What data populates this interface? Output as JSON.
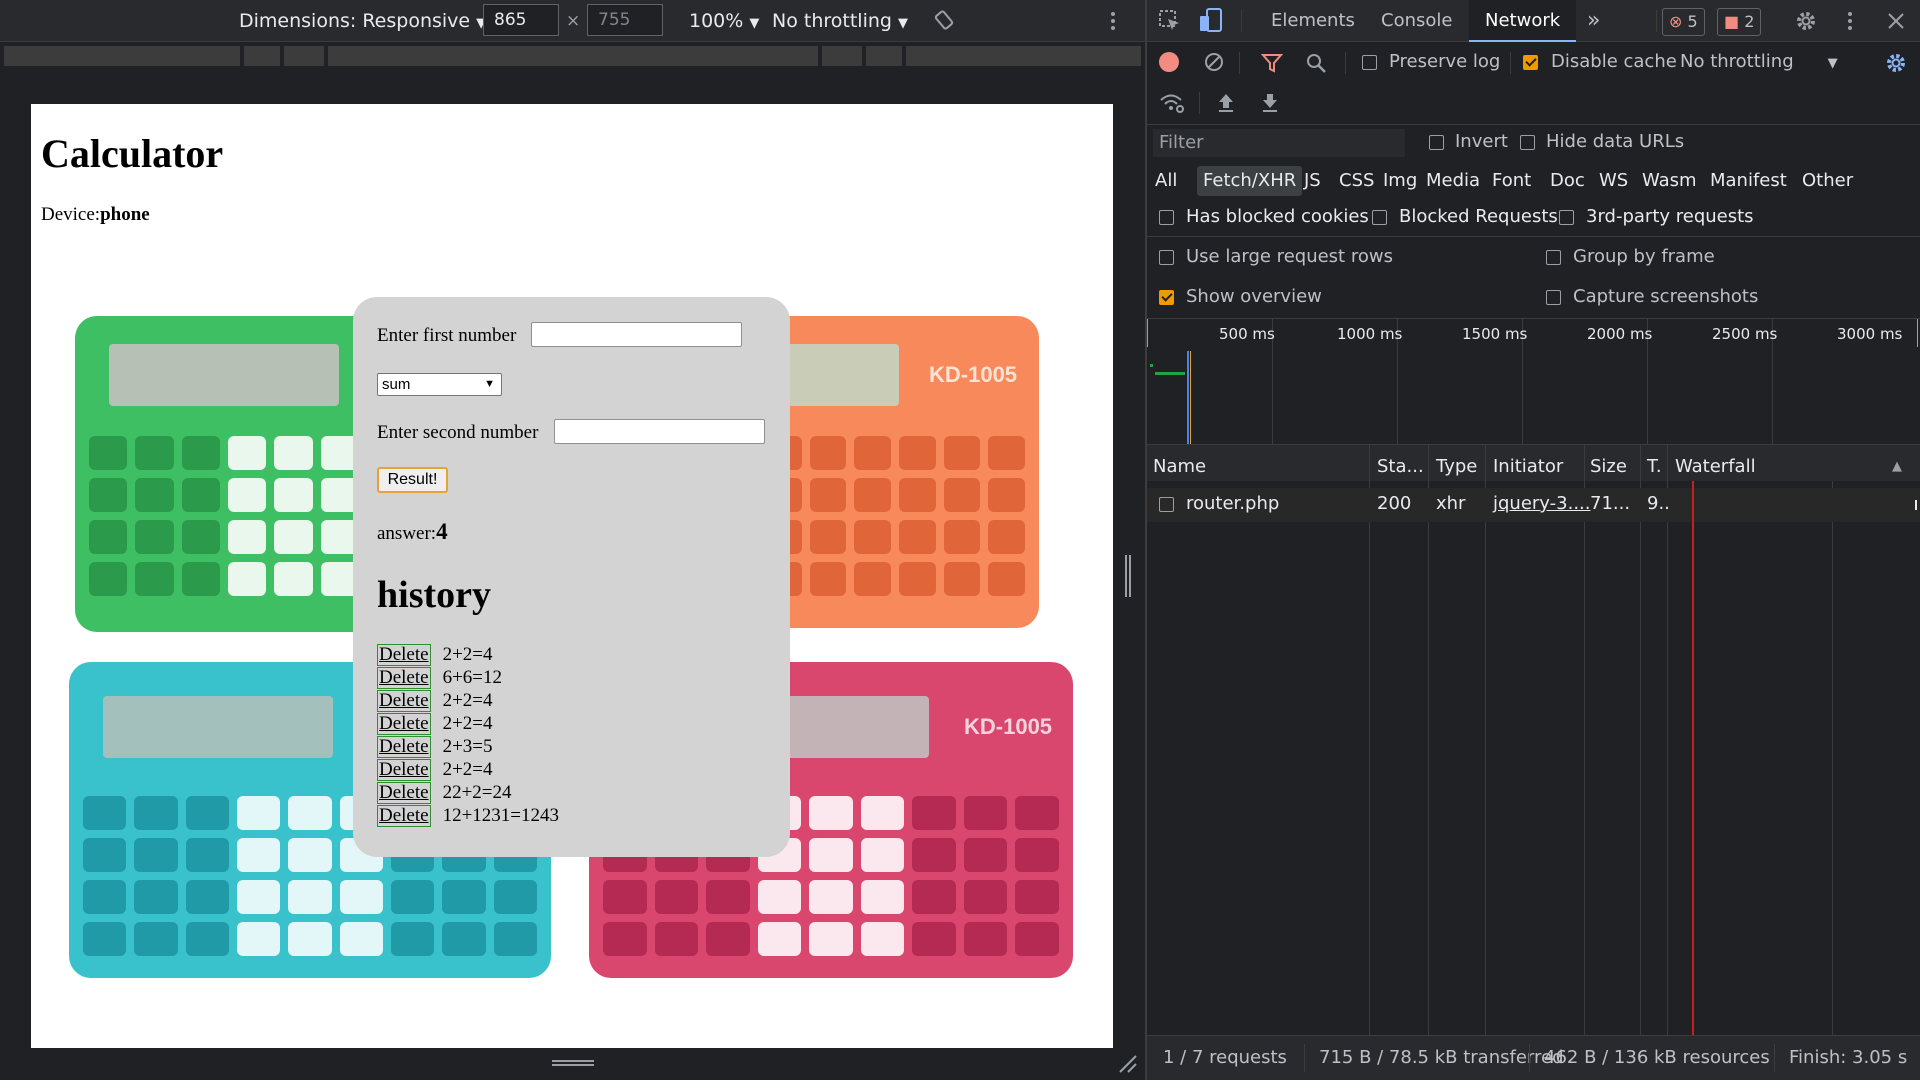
{
  "device_toolbar": {
    "dimensions_label": "Dimensions: Responsive",
    "width": "865",
    "height": "755",
    "times": "×",
    "zoom": "100%",
    "throttling": "No throttling"
  },
  "page": {
    "title": "Calculator",
    "device_label": "Device:",
    "device_value": "phone",
    "first_label": "Enter first number",
    "operation": "sum",
    "second_label": "Enter second number",
    "result_button": "Result!",
    "answer_label": "answer:",
    "answer_value": "4",
    "history_title": "history",
    "delete_label": "Delete",
    "history": [
      "2+2=4",
      "6+6=12",
      "2+2=4",
      "2+2=4",
      "2+3=5",
      "2+2=4",
      "22+2=24",
      "12+1231=1243"
    ]
  },
  "calculators": {
    "model": "KD-1005",
    "colors": {
      "green": "#3fbf63",
      "orange": "#f7895a",
      "cyan": "#39c1cc",
      "pink": "#d9466e"
    }
  },
  "devtools": {
    "tabs": [
      "Elements",
      "Console",
      "Network"
    ],
    "active_tab": "Network",
    "more": "»",
    "errors": "5",
    "warnings": "2",
    "preserve_log": "Preserve log",
    "disable_cache": "Disable cache",
    "throttling": "No throttling",
    "filter_placeholder": "Filter",
    "invert": "Invert",
    "hide_data_urls": "Hide data URLs",
    "types": [
      "All",
      "Fetch/XHR",
      "JS",
      "CSS",
      "Img",
      "Media",
      "Font",
      "Doc",
      "WS",
      "Wasm",
      "Manifest",
      "Other"
    ],
    "active_type": "Fetch/XHR",
    "has_blocked_cookies": "Has blocked cookies",
    "blocked_requests": "Blocked Requests",
    "third_party": "3rd-party requests",
    "large_rows": "Use large request rows",
    "group_by_frame": "Group by frame",
    "show_overview": "Show overview",
    "capture_screenshots": "Capture screenshots",
    "timeline_ticks": [
      "500 ms",
      "1000 ms",
      "1500 ms",
      "2000 ms",
      "2500 ms",
      "3000 ms"
    ],
    "columns": [
      "Name",
      "Sta...",
      "Type",
      "Initiator",
      "Size",
      "T.",
      "Waterfall"
    ],
    "requests": [
      {
        "name": "router.php",
        "status": "200",
        "type": "xhr",
        "initiator": "jquery-3....",
        "size": "71...",
        "time": "9.."
      }
    ],
    "status_bar": [
      "1 / 7 requests",
      "715 B / 78.5 kB transferred",
      "462 B / 136 kB resources",
      "Finish: 3.05 s"
    ]
  }
}
